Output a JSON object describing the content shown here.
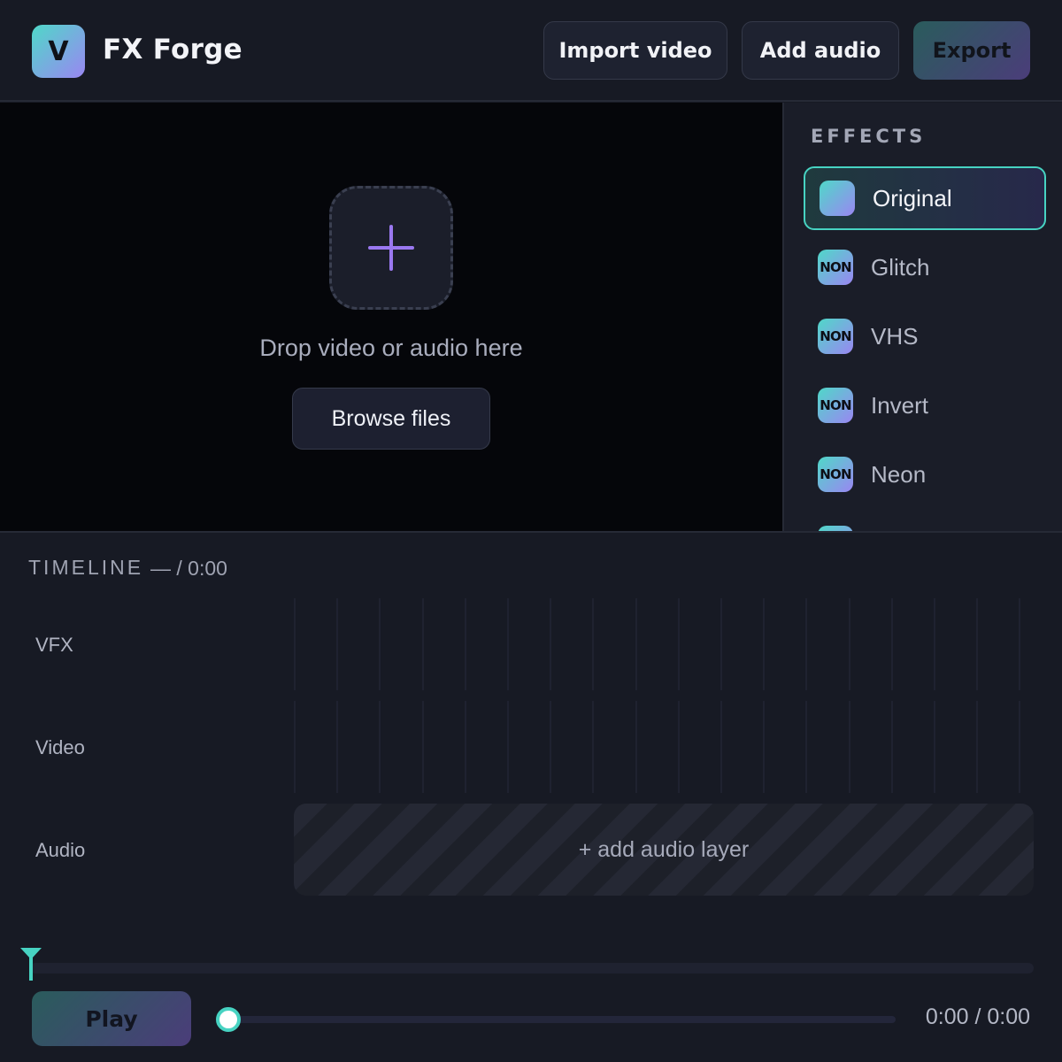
{
  "app": {
    "logo_letter": "V",
    "title": "FX Forge"
  },
  "toolbar": {
    "import_label": "Import video",
    "add_audio_label": "Add audio",
    "export_label": "Export"
  },
  "dropzone": {
    "icon": "plus-icon",
    "prompt": "Drop video or audio here",
    "browse_label": "Browse files"
  },
  "effects": {
    "title": "EFFECTS",
    "selected": "Original",
    "items": [
      {
        "label": "Original",
        "badge": ""
      },
      {
        "label": "Glitch",
        "badge": "NON"
      },
      {
        "label": "VHS",
        "badge": "NON"
      },
      {
        "label": "Invert",
        "badge": "NON"
      },
      {
        "label": "Neon",
        "badge": "NON"
      }
    ]
  },
  "timeline": {
    "title": "TIMELINE",
    "time": "— / 0:00",
    "tracks": [
      {
        "label": "VFX"
      },
      {
        "label": "Video"
      },
      {
        "label": "Audio"
      }
    ],
    "audio_placeholder": "+ add audio layer",
    "playhead_position": 0
  },
  "transport": {
    "play_label": "Play",
    "seek_progress": 0,
    "time_readout": "0:00 / 0:00"
  },
  "colors": {
    "accent_teal": "#47d3c2",
    "accent_purple": "#9a86f2",
    "background": "#171a24"
  }
}
